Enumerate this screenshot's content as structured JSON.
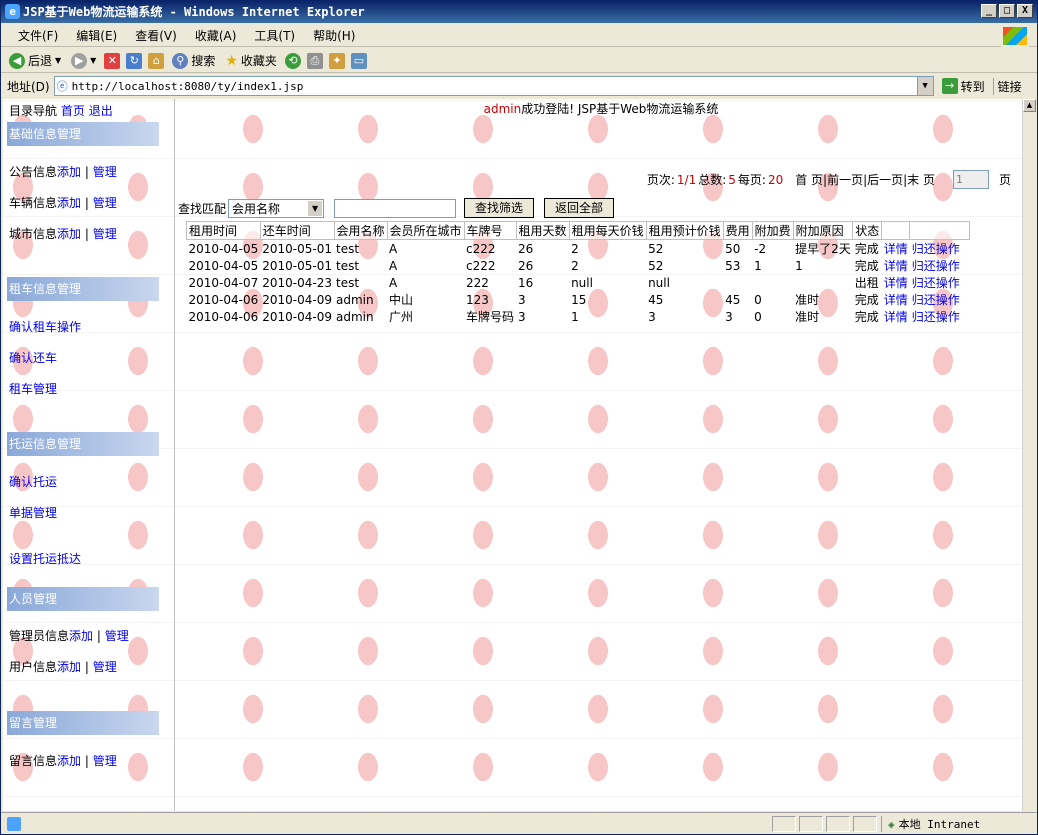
{
  "window": {
    "title": "JSP基于Web物流运输系统 - Windows Internet Explorer",
    "min": "_",
    "max": "□",
    "close": "X"
  },
  "menu": [
    "文件(F)",
    "编辑(E)",
    "查看(V)",
    "收藏(A)",
    "工具(T)",
    "帮助(H)"
  ],
  "toolbar": {
    "back": "后退",
    "search": "搜索",
    "favorites": "收藏夹"
  },
  "address": {
    "label": "地址(D)",
    "url": "http://localhost:8080/ty/index1.jsp",
    "go": "转到",
    "links": "链接"
  },
  "status": {
    "zone": "本地 Intranet"
  },
  "left_nav": {
    "top_label": "目录导航",
    "home": "首页",
    "logout": "退出",
    "sections": [
      {
        "title": "基础信息管理",
        "items": [
          {
            "prefix": "公告信息",
            "add": "添加",
            "sep": "|",
            "manage": "管理"
          },
          {
            "prefix": "车辆信息",
            "add": "添加",
            "sep": "|",
            "manage": "管理"
          },
          {
            "prefix": "城市信息",
            "add": "添加",
            "sep": "|",
            "manage": "管理"
          }
        ]
      },
      {
        "title": "租车信息管理",
        "links": [
          "确认租车操作",
          "确认还车",
          "租车管理"
        ]
      },
      {
        "title": "托运信息管理",
        "links": [
          "确认托运",
          "单据管理",
          "设置托运抵达"
        ]
      },
      {
        "title": "人员管理",
        "items": [
          {
            "prefix": "管理员信息",
            "add": "添加",
            "sep": "|",
            "manage": "管理"
          },
          {
            "prefix": "用户信息",
            "add": "添加",
            "sep": "|",
            "manage": "管理"
          }
        ]
      },
      {
        "title": "留言管理",
        "items": [
          {
            "prefix": "留言信息",
            "add": "添加",
            "sep": "|",
            "manage": "管理"
          }
        ]
      }
    ]
  },
  "main": {
    "welcome_user": "admin",
    "welcome_text": "成功登陆! JSP基于Web物流运输系统",
    "pager": {
      "page_label": "页次:",
      "page_value": "1/1",
      "total_label": "总数:",
      "total_value": "5",
      "per_label": "每页:",
      "per_value": "20",
      "nav": "首 页|前一页|后一页|末 页",
      "page_input": "1",
      "page_suffix": "页"
    },
    "search": {
      "label": "查找匹配",
      "field_selected": "会用名称",
      "search_btn": "查找筛选",
      "reset_btn": "返回全部"
    },
    "table": {
      "headers": [
        "租用时间",
        "还车时间",
        "会用名称",
        "会员所在城市",
        "车牌号",
        "租用天数",
        "租用每天价钱",
        "租用预计价钱",
        "费用",
        "附加费",
        "附加原因",
        "状态",
        "",
        ""
      ],
      "rows": [
        [
          "2010-04-05",
          "2010-05-01",
          "test",
          "A",
          "c222",
          "26",
          "2",
          "52",
          "50",
          "-2",
          "提早了2天",
          "完成",
          "详情",
          "归还操作"
        ],
        [
          "2010-04-05",
          "2010-05-01",
          "test",
          "A",
          "c222",
          "26",
          "2",
          "52",
          "53",
          "1",
          "1",
          "完成",
          "详情",
          "归还操作"
        ],
        [
          "2010-04-07",
          "2010-04-23",
          "test",
          "A",
          "222",
          "16",
          "null",
          "null",
          "",
          "",
          "",
          "出租",
          "详情",
          "归还操作"
        ],
        [
          "2010-04-06",
          "2010-04-09",
          "admin",
          "中山",
          "123",
          "3",
          "15",
          "45",
          "45",
          "0",
          "准时",
          "完成",
          "详情",
          "归还操作"
        ],
        [
          "2010-04-06",
          "2010-04-09",
          "admin",
          "广州",
          "车牌号码",
          "3",
          "1",
          "3",
          "3",
          "0",
          "准时",
          "完成",
          "详情",
          "归还操作"
        ]
      ]
    }
  }
}
